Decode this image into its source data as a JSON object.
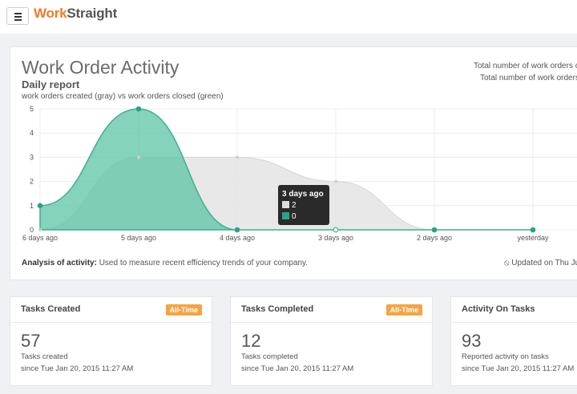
{
  "app": {
    "logo_part1": "Work",
    "logo_part2": "Straight"
  },
  "panel": {
    "title": "Work Order Activity",
    "subtitle": "Daily report",
    "caption": "work orders created (gray) vs work orders closed (green)",
    "totals": [
      "Total number of work orders cr",
      "Total number of work orders c"
    ],
    "analysis_label": "Analysis of activity:",
    "analysis_text": " Used to measure recent efficiency trends of your company.",
    "updated": "⦸ Updated on Thu Ju"
  },
  "chart_data": {
    "type": "area",
    "categories": [
      "6 days ago",
      "5 days ago",
      "4 days ago",
      "3 days ago",
      "2 days ago",
      "yesterday"
    ],
    "series": [
      {
        "name": "work orders created",
        "color": "#dcdcdc",
        "values": [
          0,
          3,
          3,
          2,
          0,
          0
        ]
      },
      {
        "name": "work orders closed",
        "color": "#5cc4a6",
        "values": [
          1,
          5,
          0,
          0,
          0,
          0
        ]
      }
    ],
    "ylim": [
      0,
      5
    ],
    "yticks": [
      0,
      1,
      2,
      3,
      4,
      5
    ],
    "grid": true,
    "tooltip": {
      "title": "3 days ago",
      "rows": [
        {
          "color": "#dcdcdc",
          "value": "2"
        },
        {
          "color": "#2aa38a",
          "value": "0"
        }
      ]
    }
  },
  "cards": [
    {
      "title": "Tasks Created",
      "badge": "All-Time",
      "number": "57",
      "label": "Tasks created",
      "since": "since Tue Jan 20, 2015 11:27 AM"
    },
    {
      "title": "Tasks Completed",
      "badge": "All-Time",
      "number": "12",
      "label": "Tasks completed",
      "since": "since Tue Jan 20, 2015 11:27 AM"
    },
    {
      "title": "Activity On Tasks",
      "badge": "",
      "number": "93",
      "label": "Reported activity on tasks",
      "since": "since Tue Jan 20, 2015 11:27 AM"
    }
  ]
}
